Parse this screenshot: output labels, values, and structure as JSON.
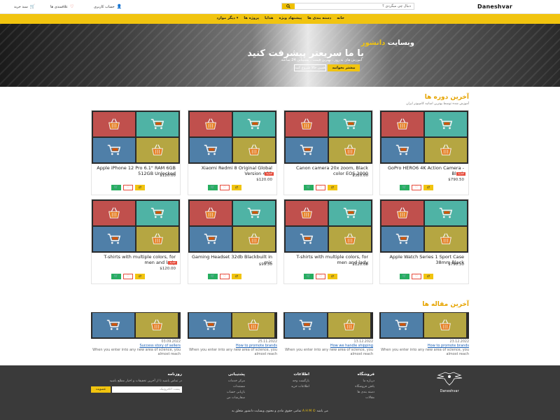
{
  "header": {
    "logo": "Daneshvar",
    "search_placeholder": "دنبال چی میگردی ؟",
    "links": {
      "account": "حساب کاربری",
      "favorites": "علاقمندی ها",
      "cart": "سبد خرید"
    }
  },
  "nav": {
    "items": [
      "خانه",
      "دسته بندی ها",
      "پیشنهاد ویژه",
      "هدایا",
      "پروژه ها",
      "دیگر موارد ▾"
    ]
  },
  "hero": {
    "title_line1_white": "وبسایت",
    "title_line1_yellow": "دانشور",
    "title_line2": "با ما سریعتر پیشرفت کنید",
    "subtitle": "آموزش های به روز ، بهترین قیمت ، پشتیبانی 24 ساعته",
    "button_primary": "بیشتر بخوانید",
    "button_secondary": "همین حالا شروع کنید"
  },
  "products_section": {
    "title": "آخرین دوره ها",
    "subtitle": "آموزش شده توسط بهترین اساتید کامپیوتر ایران"
  },
  "products": [
    {
      "name": "GoPro HERO6 4K Action Camera - Black",
      "price": "$790.50",
      "badge": "جدید"
    },
    {
      "name": "Canon camera 20x zoom, Black color EOS 2000",
      "price": "$320.00",
      "badge": ""
    },
    {
      "name": "Xiaomi Redmi 8 Original Global Version 4GB",
      "price": "$120.00",
      "badge": "جدید"
    },
    {
      "name": "Apple iPhone 12 Pro 6.1\" RAM 6GB 512GB Unlocked",
      "price": "$120.00",
      "badge": ""
    },
    {
      "name": "Apple Watch Series 1 Sport Case 38mm Black",
      "price": "$790.50",
      "badge": ""
    },
    {
      "name": "T-shirts with multiple colors, for men and lady",
      "price": "$120.00",
      "badge": ""
    },
    {
      "name": "Gaming Headset 32db Blackbuilt in mic",
      "price": "$99.50",
      "badge": ""
    },
    {
      "name": "T-shirts with multiple colors, for men and lady",
      "price": "$120.00",
      "badge": "جدید"
    }
  ],
  "articles_section": {
    "title": "آخرین مقاله ها"
  },
  "articles": [
    {
      "date": "23.12.2022",
      "title": "How to promote brands",
      "desc": "When you enter into any new area of science, you almost reach"
    },
    {
      "date": "13.12.2022",
      "title": "How we handle shipping",
      "desc": "When you enter into any new area of science, you almost reach"
    },
    {
      "date": "25.11.2022",
      "title": "How to promote brands",
      "desc": "When you enter into any new area of science, you almost reach"
    },
    {
      "date": "03.09.2022",
      "title": "Success story of sellers",
      "desc": "When you enter into any new area of science, you almost reach"
    }
  ],
  "footer": {
    "logo_name": "Daneshvar",
    "store": {
      "heading": "فروشگاه",
      "links": [
        "درباره ما",
        "یافتن فروشگاه",
        "دسته بندی ها",
        "مقالات"
      ]
    },
    "info": {
      "heading": "اطلاعات",
      "links": [
        "بازگشت وجه",
        "اطلاعات خرید"
      ]
    },
    "support": {
      "heading": "پشتیبانی",
      "links": [
        "مرکز خدمات",
        "مستندات",
        "بازیابی حساب",
        "سفارشات من"
      ]
    },
    "newsletter": {
      "heading": "روزنامه",
      "text": "در تماس باشید تا از آخرین تخفیفات و اخبار مطلع باشید",
      "placeholder": "پست الکترونیک",
      "button": "عضویت"
    },
    "copyright_pre": "تمامی حقوق مادی و معنوی وبسایت دانشور متعلق به",
    "copyright_brand": "A H M ©",
    "copyright_post": "می باشد"
  },
  "colors": {
    "accent": "#f1c40f",
    "tile_red": "#c0504d",
    "tile_teal": "#4fb3a5",
    "tile_blue": "#4f7fa8",
    "tile_olive": "#b5a642"
  }
}
